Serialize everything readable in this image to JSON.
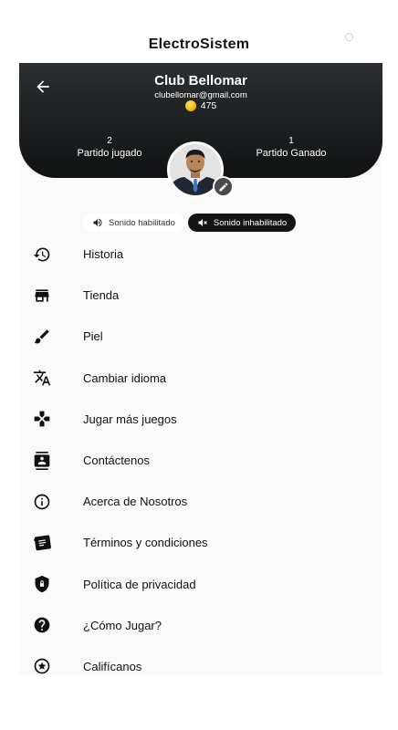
{
  "app": {
    "title": "ElectroSistem"
  },
  "profile": {
    "name": "Club Bellomar",
    "email": "clubellomar@gmail.com",
    "coins": "475"
  },
  "stats": {
    "played": {
      "value": "2",
      "label": "Partido jugado"
    },
    "won": {
      "value": "1",
      "label": "Partido Ganado"
    }
  },
  "sound": {
    "enabled_label": "Sonido habilitado",
    "disabled_label": "Sonido inhabilitado",
    "selected": "disabled"
  },
  "menu": {
    "items": [
      {
        "label": "Historia",
        "icon": "history-icon"
      },
      {
        "label": "Tienda",
        "icon": "store-icon"
      },
      {
        "label": "Piel",
        "icon": "brush-icon"
      },
      {
        "label": "Cambiar idioma",
        "icon": "translate-icon"
      },
      {
        "label": "Jugar más juegos",
        "icon": "gamepad-icon"
      },
      {
        "label": "Contáctenos",
        "icon": "contacts-icon"
      },
      {
        "label": "Acerca de Nosotros",
        "icon": "info-icon"
      },
      {
        "label": "Términos y condiciones",
        "icon": "terms-icon"
      },
      {
        "label": "Política de privacidad",
        "icon": "privacy-shield-icon"
      },
      {
        "label": "¿Cómo Jugar?",
        "icon": "help-icon"
      },
      {
        "label": "Califícanos",
        "icon": "rate-star-icon"
      }
    ]
  },
  "colors": {
    "header": "#1b1d1f",
    "background": "#fafafa",
    "coin": "#f5b800",
    "pill_active": "#141414"
  }
}
